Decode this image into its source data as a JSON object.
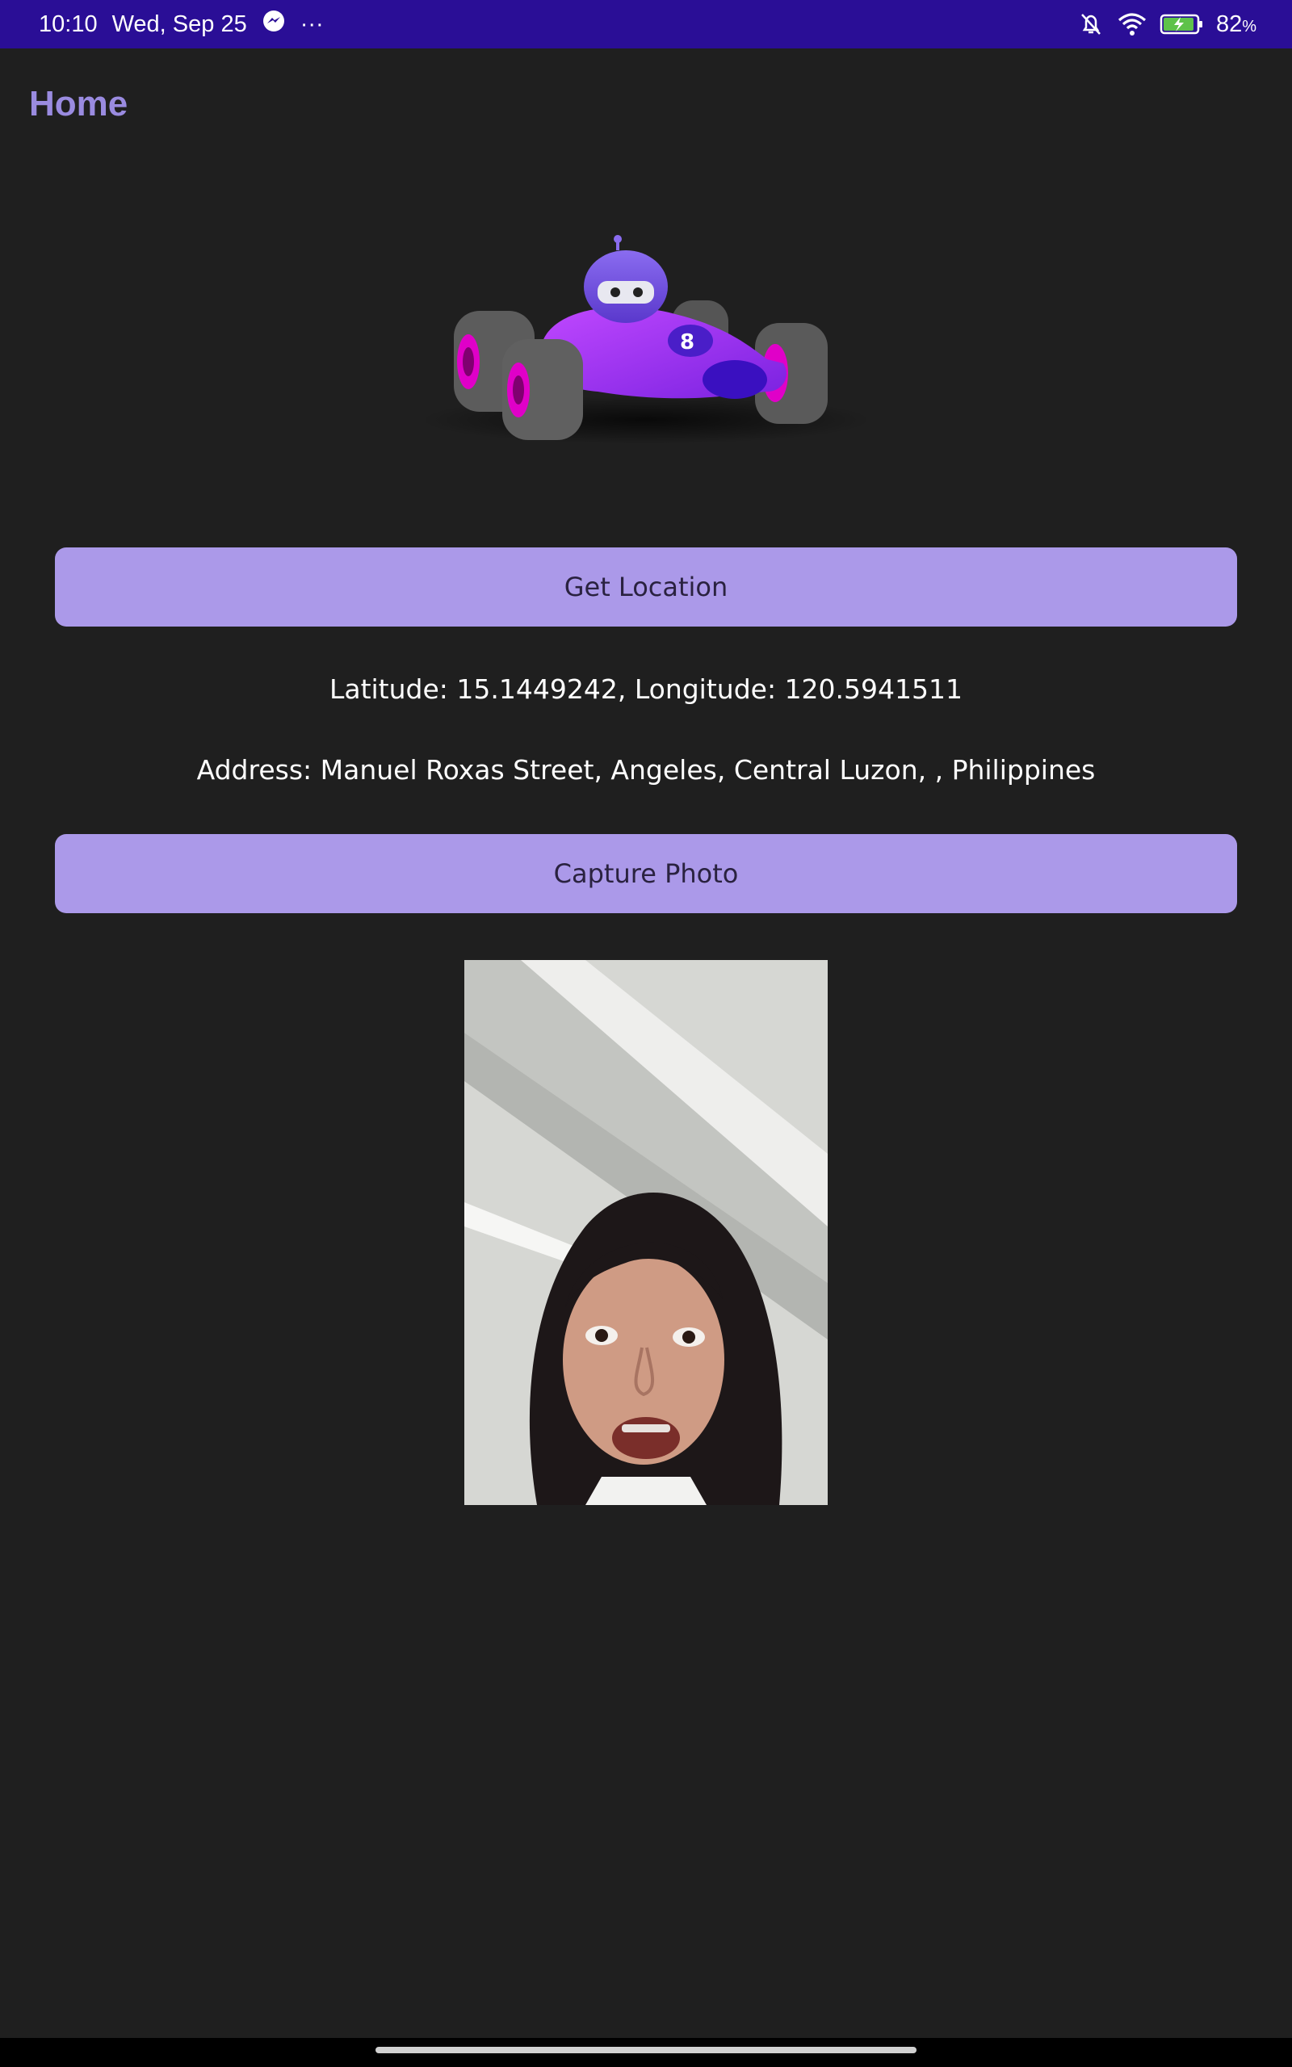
{
  "status_bar": {
    "time": "10:10",
    "date": "Wed, Sep 25",
    "more": "···",
    "battery_percent": "82",
    "battery_unit": "%",
    "icons": [
      "messenger-icon",
      "bell-off-icon",
      "wifi-icon",
      "battery-charging-icon"
    ]
  },
  "page": {
    "title": "Home"
  },
  "location": {
    "button_label": "Get Location",
    "coordinates_text": "Latitude: 15.1449242, Longitude: 120.5941511",
    "address_text": "Address: Manuel Roxas Street, Angeles, Central Luzon, , Philippines"
  },
  "photo": {
    "button_label": "Capture Photo"
  },
  "colors": {
    "status_bar": "#2a0e96",
    "background": "#1f1f1f",
    "title": "#9a8be0",
    "button": "#ab99e9",
    "button_text": "#2a2240"
  }
}
